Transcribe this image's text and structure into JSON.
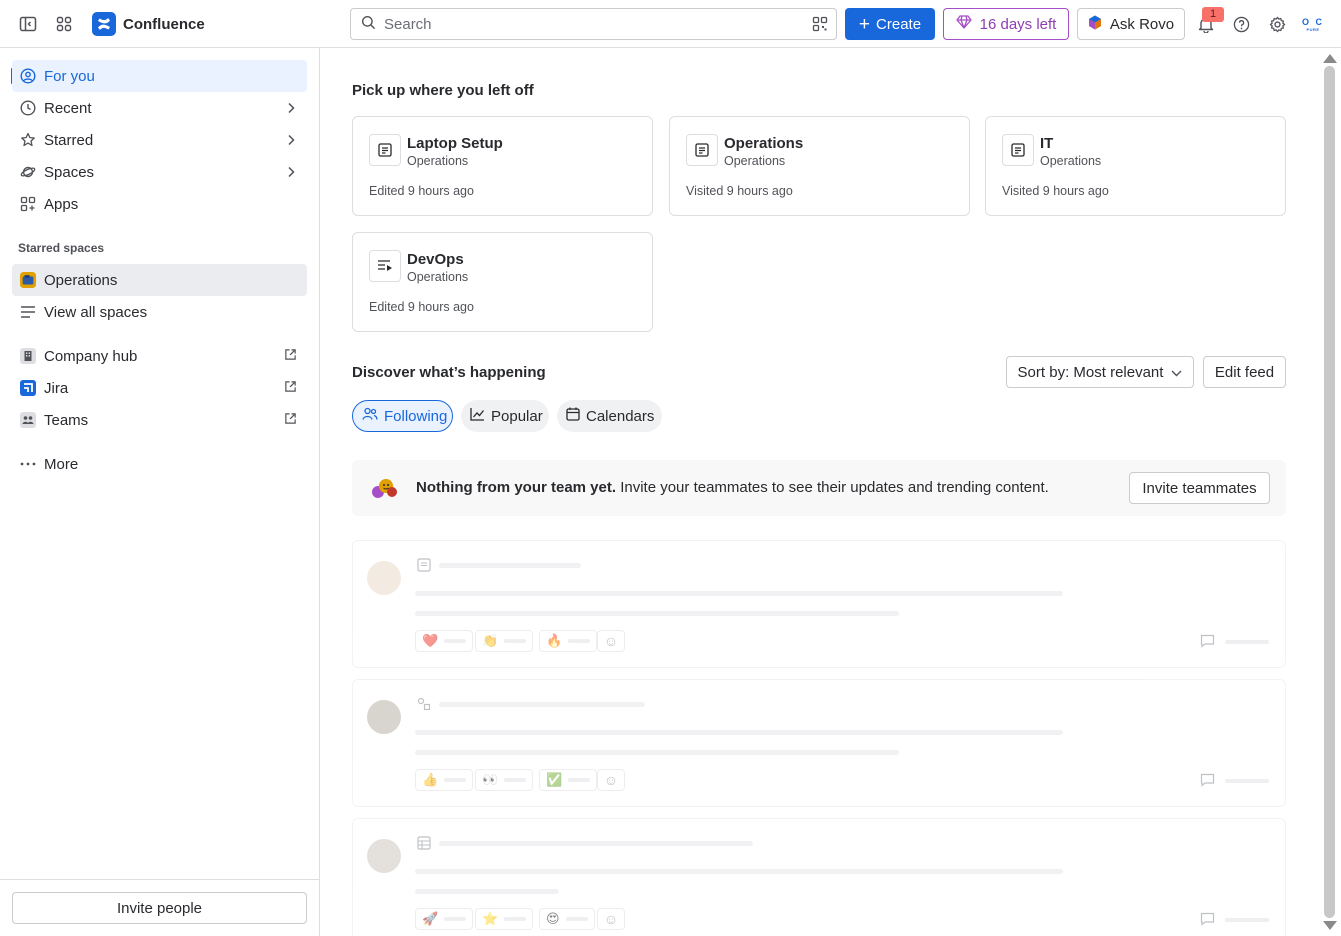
{
  "app": {
    "name": "Confluence"
  },
  "topbar": {
    "search_placeholder": "Search",
    "create_label": "Create",
    "trial_label": "16 days left",
    "rovo_label": "Ask Rovo",
    "notification_count": "1",
    "avatar_initials_top": "O C",
    "avatar_initials_bottom": "PURE"
  },
  "sidebar": {
    "items": [
      {
        "label": "For you",
        "icon": "user-circle-icon"
      },
      {
        "label": "Recent",
        "icon": "clock-icon"
      },
      {
        "label": "Starred",
        "icon": "star-icon"
      },
      {
        "label": "Spaces",
        "icon": "planet-icon"
      },
      {
        "label": "Apps",
        "icon": "apps-icon"
      }
    ],
    "starred_label": "Starred spaces",
    "starred_spaces": [
      {
        "label": "Operations"
      }
    ],
    "view_all_spaces": "View all spaces",
    "links": [
      {
        "label": "Company hub",
        "icon": "building-icon"
      },
      {
        "label": "Jira",
        "icon": "jira-icon"
      },
      {
        "label": "Teams",
        "icon": "teams-icon"
      }
    ],
    "more_label": "More",
    "invite_people": "Invite people"
  },
  "main": {
    "pickup_title": "Pick up where you left off",
    "cards": [
      {
        "title": "Laptop Setup",
        "space": "Operations",
        "meta": "Edited 9 hours ago",
        "icon": "page-icon"
      },
      {
        "title": "Operations",
        "space": "Operations",
        "meta": "Visited 9 hours ago",
        "icon": "page-icon"
      },
      {
        "title": "IT",
        "space": "Operations",
        "meta": "Visited 9 hours ago",
        "icon": "page-icon"
      },
      {
        "title": "DevOps",
        "space": "Operations",
        "meta": "Edited 9 hours ago",
        "icon": "live-doc-icon"
      }
    ],
    "discover_title": "Discover what’s happening",
    "sort_label": "Sort by: Most relevant",
    "edit_feed_label": "Edit feed",
    "tabs": [
      {
        "label": "Following",
        "icon": "people-icon"
      },
      {
        "label": "Popular",
        "icon": "trend-icon"
      },
      {
        "label": "Calendars",
        "icon": "calendar-icon"
      }
    ],
    "banner": {
      "bold": "Nothing from your team yet.",
      "text": " Invite your teammates to see their updates and trending content.",
      "button": "Invite teammates"
    },
    "feed_reactions": [
      [
        "❤️",
        "👏",
        "🔥"
      ],
      [
        "👍",
        "👀",
        "✅"
      ],
      [
        "🚀",
        "⭐",
        "😍"
      ]
    ]
  },
  "colors": {
    "brand": "#1868db",
    "trial": "#8f3db3",
    "badge": "#f87168"
  }
}
